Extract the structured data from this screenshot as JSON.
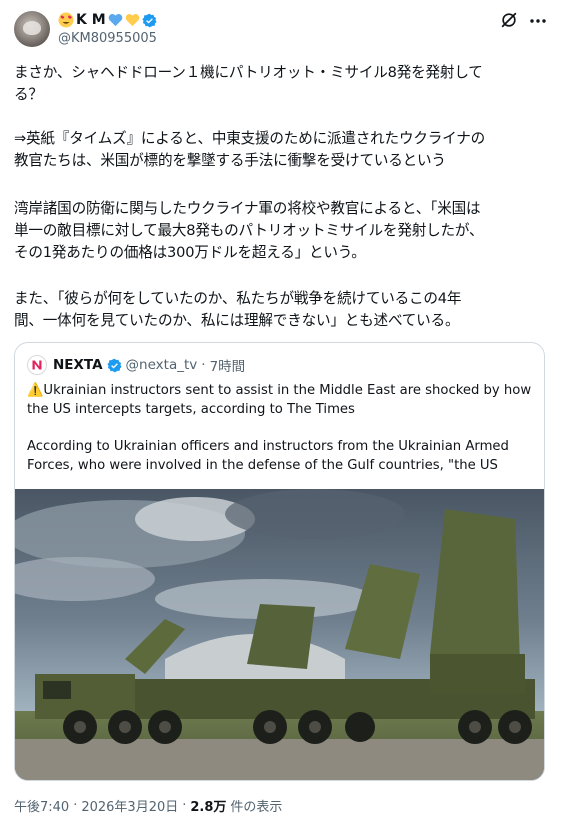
{
  "user": {
    "name": "K M",
    "handle": "@KM80955005",
    "heart_colors": [
      "#5aa9ef",
      "#ffcc4d"
    ]
  },
  "tweet": {
    "paragraphs": [
      "まさか、シャヘドドローン１機にパトリオット・ミサイル8発を発射して\nる？",
      "⇒英紙『タイムズ』によると、中東支援のために派遣されたウクライナの\n教官たちは、米国が標的を撃墜する手法に衝撃を受けているという",
      "湾岸諸国の防衛に関与したウクライナ軍の将校や教官によると、「米国は\n単一の敵目標に対して最大8発ものパトリオットミサイルを発射したが、\nその1発あたりの価格は300万ドルを超える」という。",
      "また、「彼らが何をしていたのか、私たちが戦争を続けているこの4年\n間、一体何を見ていたのか、私には理解できない」とも述べている。"
    ]
  },
  "quote": {
    "name": "NEXTA",
    "handle": "@nexta_tv",
    "separator": "·",
    "time": "7時間",
    "warning_icon": "⚠️",
    "text1": "Ukrainian instructors sent to assist in the Middle East are shocked by how the US intercepts targets, according to The Times",
    "text2": "According to Ukrainian officers and instructors from the Ukrainian Armed Forces, who were involved in the defense of the Gulf countries, \"the US"
  },
  "footer": {
    "time": "午後7:40",
    "dot": "·",
    "date": "2026年3月20日",
    "views_count": "2.8万",
    "views_label": "件の表示"
  },
  "colors": {
    "accent": "#1d9bf0",
    "text": "#0f1419",
    "muted": "#536471",
    "border": "#cfd9de"
  }
}
